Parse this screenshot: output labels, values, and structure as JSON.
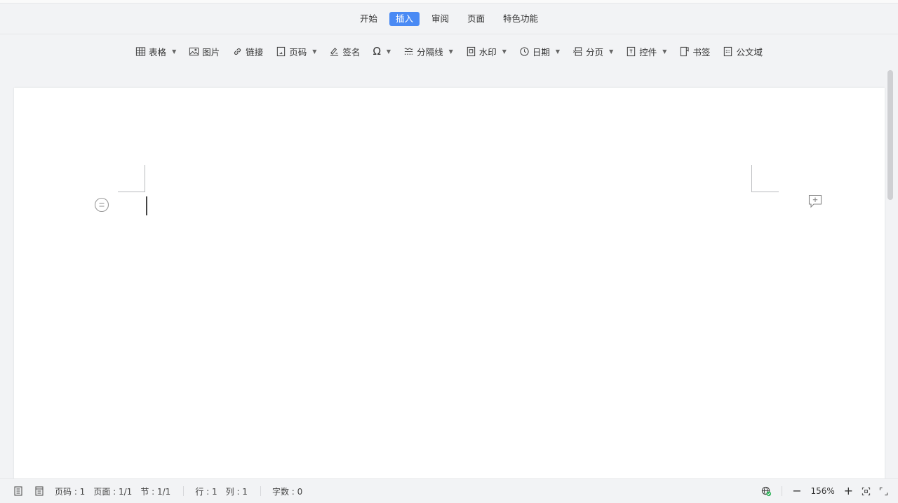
{
  "tabs": [
    {
      "label": "开始",
      "active": false
    },
    {
      "label": "插入",
      "active": true
    },
    {
      "label": "审阅",
      "active": false
    },
    {
      "label": "页面",
      "active": false
    },
    {
      "label": "特色功能",
      "active": false
    }
  ],
  "toolbar": {
    "table": {
      "label": "表格",
      "icon": "table-icon"
    },
    "image": {
      "label": "图片",
      "icon": "image-icon"
    },
    "link": {
      "label": "链接",
      "icon": "link-icon"
    },
    "page_number": {
      "label": "页码",
      "icon": "page-number-icon"
    },
    "signature": {
      "label": "签名",
      "icon": "signature-icon"
    },
    "symbol": {
      "label": "",
      "icon": "omega-icon"
    },
    "divider": {
      "label": "分隔线",
      "icon": "divider-icon"
    },
    "watermark": {
      "label": "水印",
      "icon": "watermark-icon"
    },
    "date": {
      "label": "日期",
      "icon": "clock-icon"
    },
    "page_break": {
      "label": "分页",
      "icon": "page-break-icon"
    },
    "control": {
      "label": "控件",
      "icon": "control-icon"
    },
    "bookmark": {
      "label": "书签",
      "icon": "bookmark-icon"
    },
    "doc_field": {
      "label": "公文域",
      "icon": "doc-field-icon"
    }
  },
  "statusbar": {
    "page_num": "页码 : 1",
    "page": "页面 : 1/1",
    "section": "节 : 1/1",
    "row": "行 : 1",
    "col": "列 : 1",
    "word_count": "字数 : 0",
    "zoom": "156%"
  },
  "colors": {
    "accent": "#4a8af4",
    "background": "#f2f3f5",
    "status_ok": "#2fb35a"
  }
}
